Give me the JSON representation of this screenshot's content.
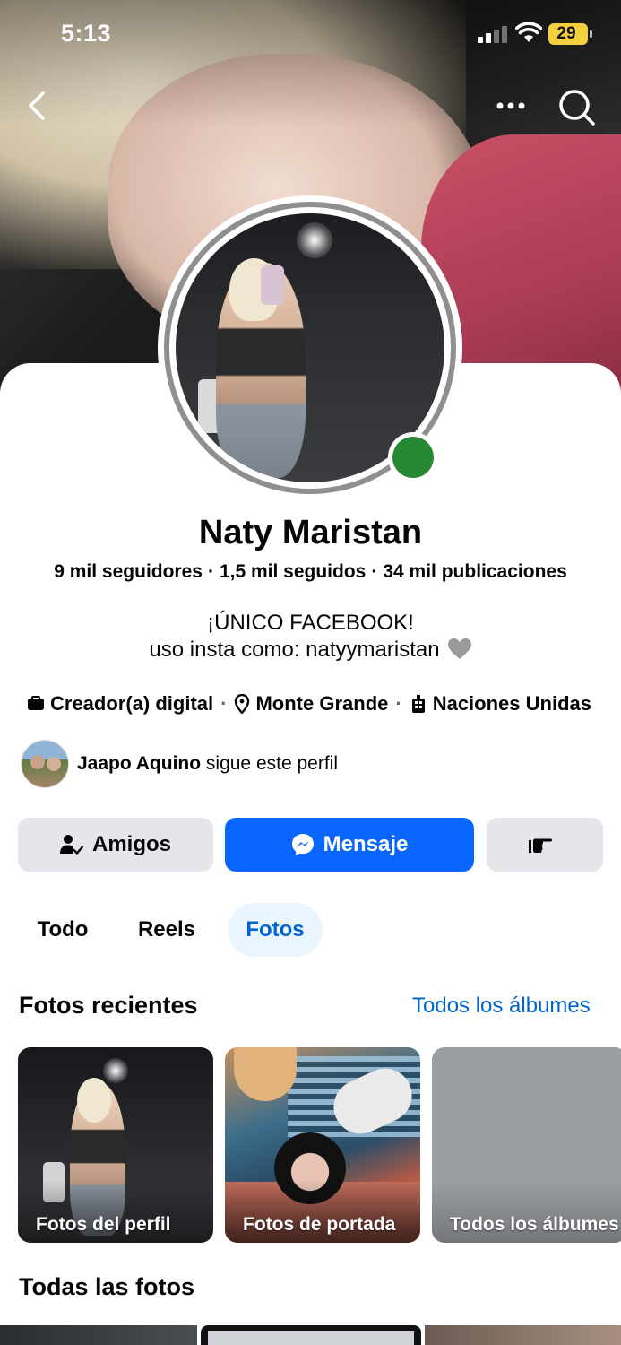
{
  "status_bar": {
    "time": "5:13",
    "battery": "29",
    "battery_color": "#f4d03f"
  },
  "nav": {
    "back_icon": "chevron-left-icon",
    "more_icon": "more-horizontal-icon",
    "search_icon": "search-icon"
  },
  "profile": {
    "name": "Naty Maristan",
    "followers": "9 mil seguidores",
    "following": "1,5 mil seguidos",
    "posts": "34 mil publicaciones",
    "separator": "·",
    "bio_line1": "¡ÚNICO FACEBOOK!",
    "bio_line2": "uso insta como: natyymaristan",
    "bio_emoji": "grey-heart-icon",
    "online_color": "#278834"
  },
  "info": {
    "category": "Creador(a) digital",
    "location": "Monte Grande",
    "workplace": "Naciones Unidas",
    "category_icon": "briefcase-icon",
    "location_icon": "map-pin-icon",
    "workplace_icon": "building-icon"
  },
  "mutual": {
    "name": "Jaapo Aquino",
    "text": "sigue este perfil"
  },
  "actions": {
    "friends_label": "Amigos",
    "message_label": "Mensaje",
    "poke_icon": "poke-hand-icon",
    "message_color": "#0866ff"
  },
  "tabs": [
    {
      "label": "Todo",
      "active": false
    },
    {
      "label": "Reels",
      "active": false
    },
    {
      "label": "Fotos",
      "active": true
    }
  ],
  "photos": {
    "recent_title": "Fotos recientes",
    "all_albums_link": "Todos los álbumes",
    "albums": [
      {
        "label": "Fotos del perfil"
      },
      {
        "label": "Fotos de portada"
      },
      {
        "label": "Todos los álbumes"
      }
    ],
    "all_title": "Todas las fotos",
    "link_color": "#0064d1"
  }
}
